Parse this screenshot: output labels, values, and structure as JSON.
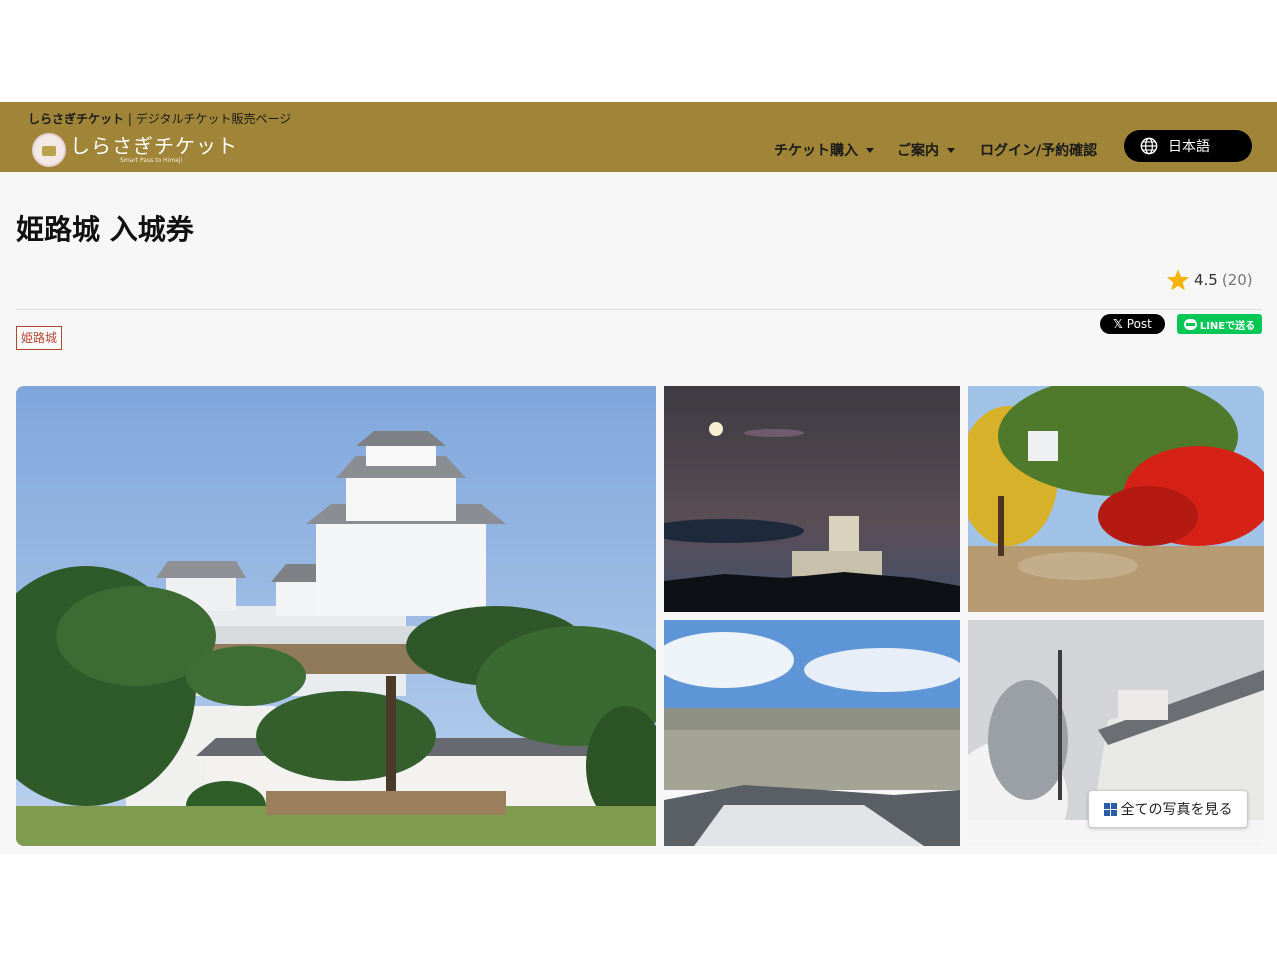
{
  "header": {
    "tagline_brand": "しらさぎチケット",
    "tagline_rest": " | デジタルチケット販売ページ",
    "logo_text": "しらさぎチケット",
    "logo_subtext": "Smart Pass to Himeji",
    "nav": {
      "buy_tickets": "チケット購入",
      "info": "ご案内",
      "login": "ログイン/予約確認"
    },
    "language": "日本語"
  },
  "product": {
    "title": "姫路城 入城券",
    "rating_score": "4.5",
    "rating_count": "(20)",
    "tag": "姫路城"
  },
  "share": {
    "x_post": "Post",
    "line": "LINEで送る"
  },
  "gallery": {
    "view_all": "全ての写真を見る"
  },
  "colors": {
    "header_bg": "#a08438",
    "tag_border": "#b2452d",
    "line_green": "#06c755"
  }
}
